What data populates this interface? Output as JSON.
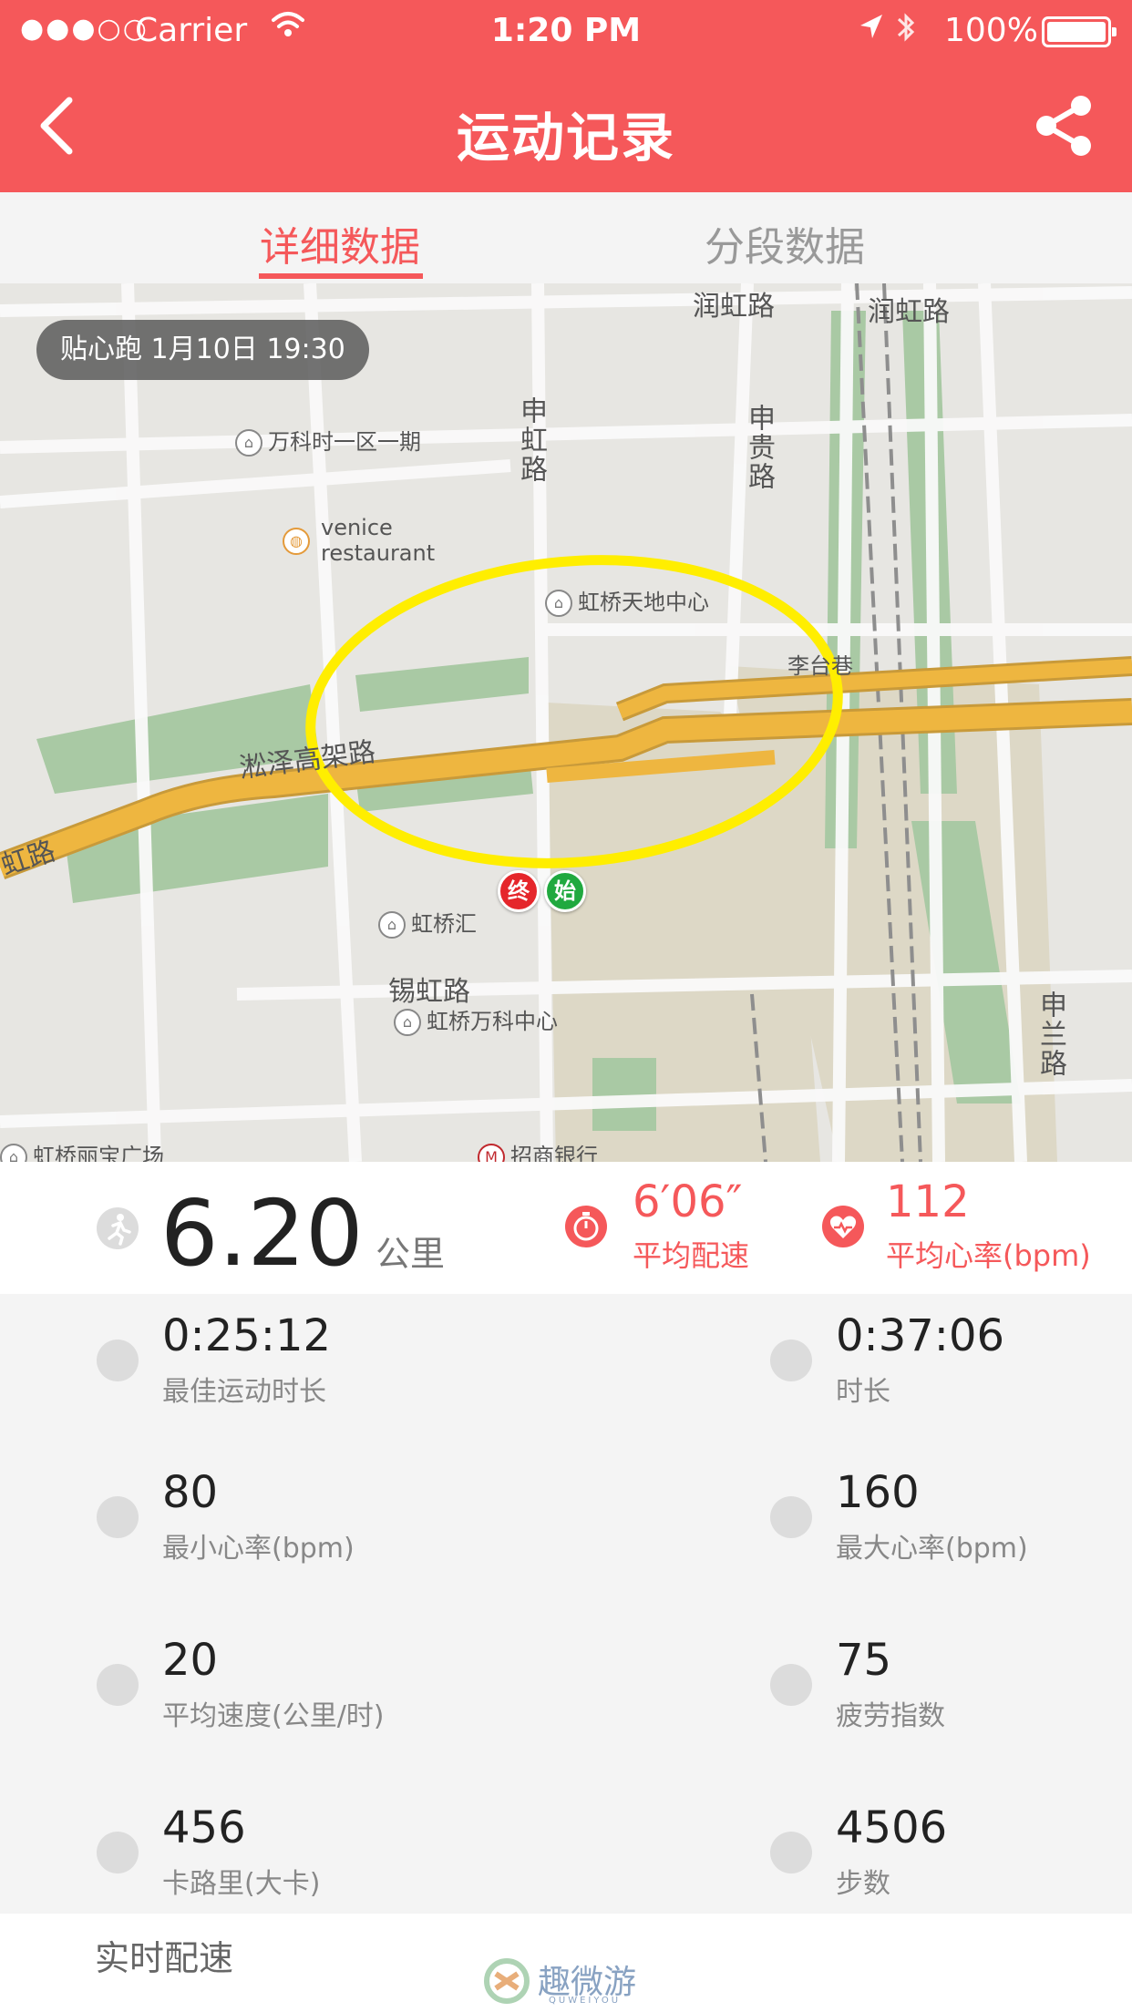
{
  "status_bar": {
    "signal": "●●●○○",
    "carrier": "Carrier",
    "time": "1:20 PM",
    "battery": "100%"
  },
  "nav": {
    "title": "运动记录"
  },
  "tabs": [
    {
      "label": "详细数据",
      "active": true
    },
    {
      "label": "分段数据",
      "active": false
    }
  ],
  "map": {
    "badge": "贴心跑  1月10日 19:30",
    "pois": [
      "万科时一区一期",
      "venice",
      "restaurant",
      "虹桥天地中心",
      "虹桥汇",
      "虹桥万科中心",
      "虹桥丽宝广场",
      "招商银行"
    ],
    "roads": [
      "润虹路",
      "润虹路",
      "申虹路",
      "申贵路",
      "淞泽高架路",
      "锡虹路",
      "申兰路",
      "李台巷",
      "虹路"
    ],
    "start_pin": "始",
    "end_pin": "终"
  },
  "summary": {
    "distance": "6.20",
    "distance_unit": "公里",
    "pace_value": "6′06″",
    "pace_label": "平均配速",
    "hr_value": "112",
    "hr_label": "平均心率(bpm)"
  },
  "stats": [
    {
      "value": "0:25:12",
      "label": "最佳运动时长",
      "icon": "best-duration-icon"
    },
    {
      "value": "0:37:06",
      "label": "时长",
      "icon": "clock-icon"
    },
    {
      "value": "80",
      "label": "最小心率(bpm)",
      "icon": "min-heart-rate-icon"
    },
    {
      "value": "160",
      "label": "最大心率(bpm)",
      "icon": "max-heart-rate-icon"
    },
    {
      "value": "20",
      "label": "平均速度(公里/时)",
      "icon": "speedometer-icon"
    },
    {
      "value": "75",
      "label": "疲劳指数",
      "icon": "fatigue-icon"
    },
    {
      "value": "456",
      "label": "卡路里(大卡)",
      "icon": "flame-icon"
    },
    {
      "value": "4506",
      "label": "步数",
      "icon": "footprints-icon"
    }
  ],
  "footer": {
    "section_title": "实时配速",
    "watermark": "趣微游",
    "watermark_sub": "QUWEIYOU"
  },
  "colors": {
    "accent": "#f5585a",
    "route": "#ffee00",
    "start": "#20a93f",
    "end": "#e5262b"
  }
}
